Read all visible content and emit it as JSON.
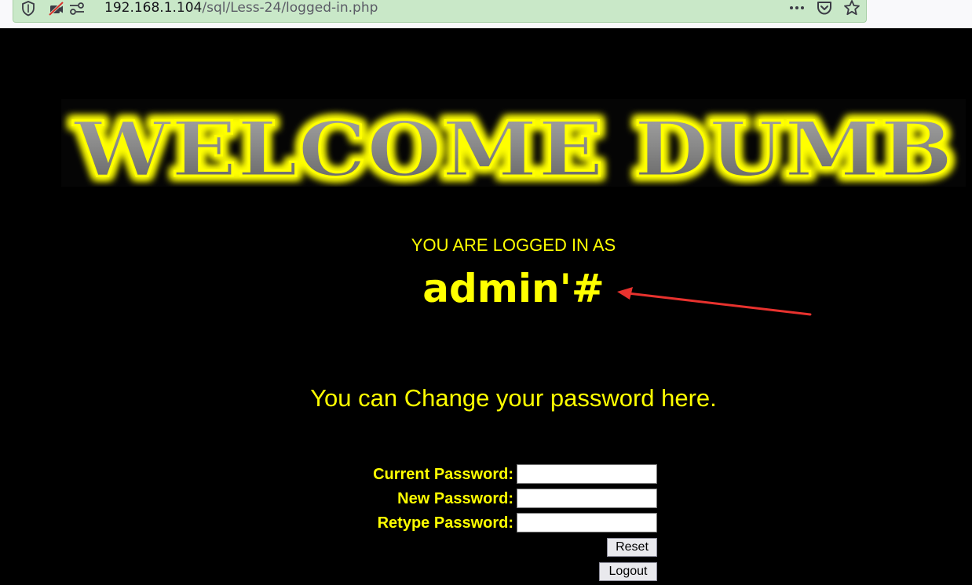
{
  "browser": {
    "url_host": "192.168.1.104",
    "url_path": "/sql/Less-24/logged-in.php",
    "icons": [
      "shield-icon",
      "camera-blocked-icon",
      "permissions-icon",
      "more-menu-icon",
      "pocket-icon",
      "bookmark-star-icon"
    ]
  },
  "page": {
    "banner_text": "WELCOME DUMB",
    "logged_in_label": "YOU ARE LOGGED IN AS",
    "username": "admin'#",
    "change_password_text": "You can Change your password here.",
    "form": {
      "current_password_label": "Current Password:",
      "new_password_label": "New Password:",
      "retype_password_label": "Retype Password:",
      "current_password_value": "",
      "new_password_value": "",
      "retype_password_value": "",
      "reset_label": "Reset",
      "logout_label": "Logout"
    }
  },
  "colors": {
    "page_background": "#000000",
    "text": "#ffff00",
    "url_bar": "#c9e8c8",
    "annotation_arrow": "#e8322e"
  }
}
